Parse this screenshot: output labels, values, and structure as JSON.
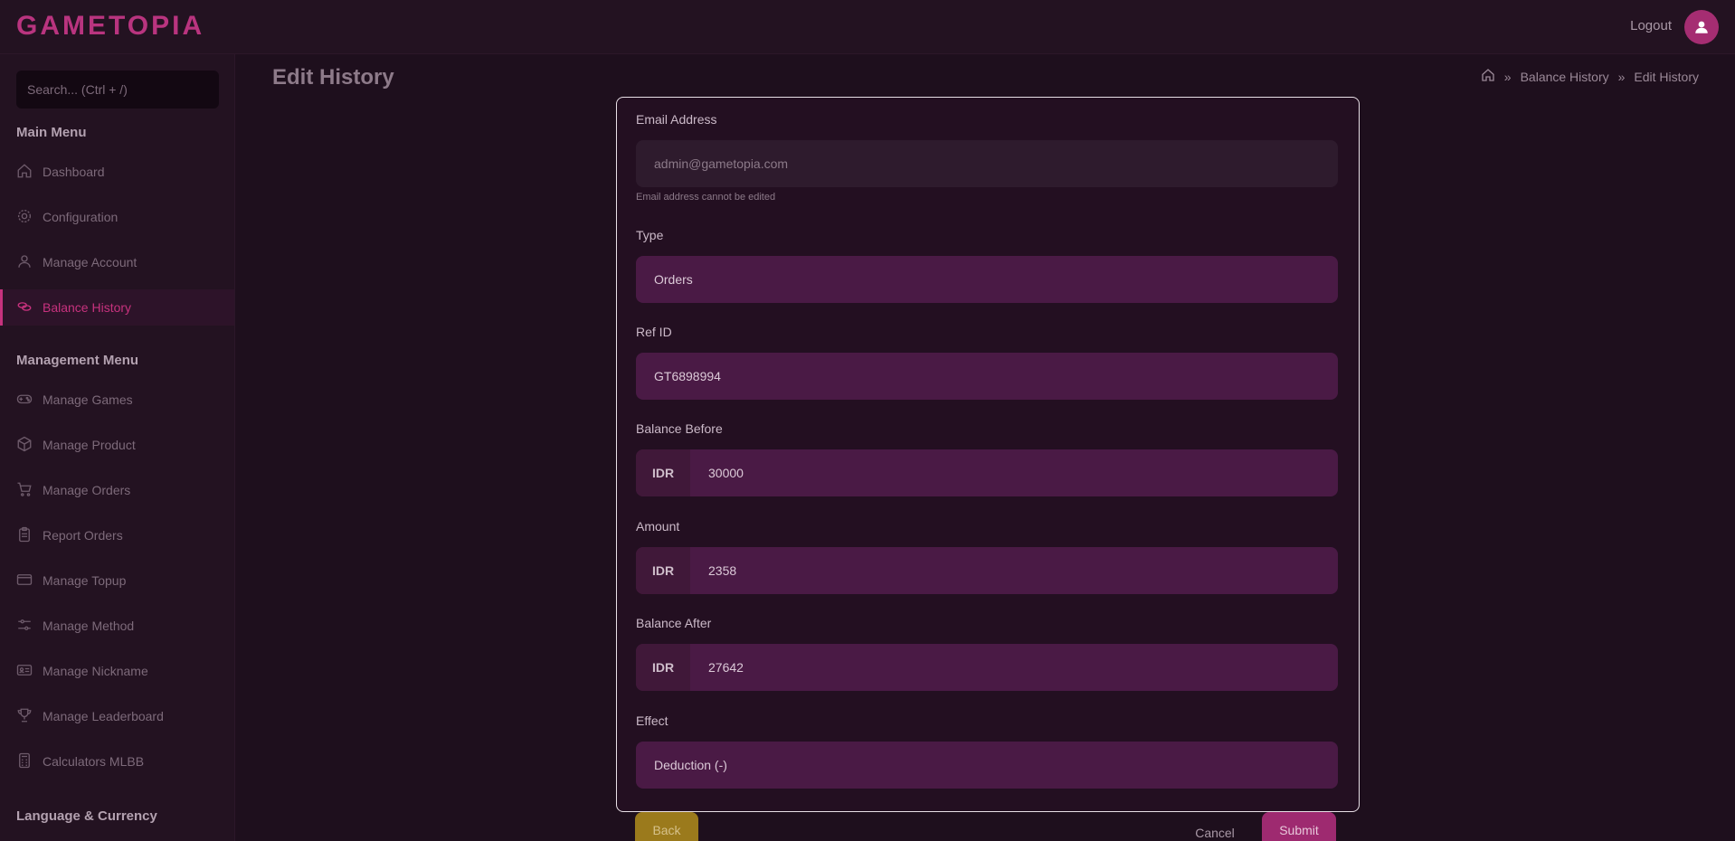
{
  "app": {
    "logo": "GAMETOPIA"
  },
  "header": {
    "logout_label": "Logout"
  },
  "sidebar": {
    "search_placeholder": "Search... (Ctrl + /)",
    "main_menu_title": "Main Menu",
    "main_items": [
      {
        "label": "Dashboard",
        "icon": "home-icon"
      },
      {
        "label": "Configuration",
        "icon": "gear-icon"
      },
      {
        "label": "Manage Account",
        "icon": "user-icon"
      },
      {
        "label": "Balance History",
        "icon": "coins-icon",
        "active": true
      }
    ],
    "management_menu_title": "Management Menu",
    "management_items": [
      {
        "label": "Manage Games",
        "icon": "gamepad-icon"
      },
      {
        "label": "Manage Product",
        "icon": "box-icon"
      },
      {
        "label": "Manage Orders",
        "icon": "cart-icon"
      },
      {
        "label": "Report Orders",
        "icon": "clipboard-icon"
      },
      {
        "label": "Manage Topup",
        "icon": "wallet-icon"
      },
      {
        "label": "Manage Method",
        "icon": "sliders-icon"
      },
      {
        "label": "Manage Nickname",
        "icon": "id-card-icon"
      },
      {
        "label": "Manage Leaderboard",
        "icon": "trophy-icon"
      },
      {
        "label": "Calculators MLBB",
        "icon": "calculator-icon"
      }
    ],
    "language_title": "Language & Currency"
  },
  "page": {
    "title": "Edit History",
    "breadcrumb": [
      "Balance History",
      "Edit History"
    ]
  },
  "form": {
    "email": {
      "label": "Email Address",
      "value": "admin@gametopia.com",
      "hint": "Email address cannot be edited"
    },
    "type": {
      "label": "Type",
      "value": "Orders"
    },
    "ref_id": {
      "label": "Ref ID",
      "value": "GT6898994"
    },
    "balance_before": {
      "label": "Balance Before",
      "prefix": "IDR",
      "value": "30000"
    },
    "amount": {
      "label": "Amount",
      "prefix": "IDR",
      "value": "2358"
    },
    "balance_after": {
      "label": "Balance After",
      "prefix": "IDR",
      "value": "27642"
    },
    "effect": {
      "label": "Effect",
      "value": "Deduction (-)"
    }
  },
  "actions": {
    "back": "Back",
    "cancel": "Cancel",
    "submit": "Submit"
  },
  "colors": {
    "accent": "#c7327e",
    "field_bg": "#4a1a45",
    "back_button": "#9b7a1c",
    "submit_button": "#9e2a70"
  }
}
